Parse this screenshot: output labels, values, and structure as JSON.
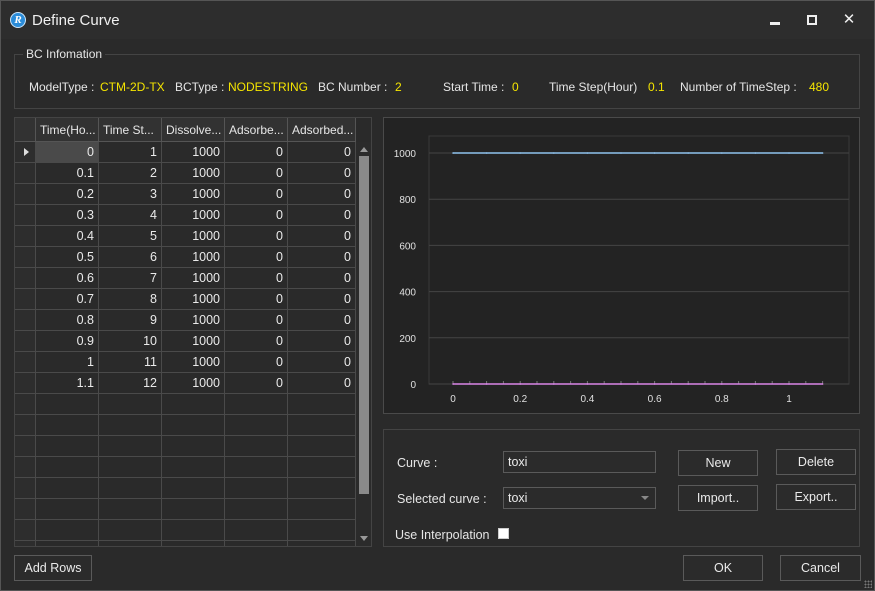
{
  "window": {
    "title": "Define Curve",
    "icon": "r-logo-icon"
  },
  "bc_info": {
    "group_title": "BC Infomation",
    "model_type_label": "ModelType :",
    "model_type_value": "CTM-2D-TX",
    "bc_type_label": "BCType :",
    "bc_type_value": "NODESTRING",
    "bc_number_label": "BC Number :",
    "bc_number_value": "2",
    "start_time_label": "Start Time :",
    "start_time_value": "0",
    "time_step_label": "Time Step(Hour)",
    "time_step_value": "0.1",
    "num_timestep_label": "Number of TimeStep :",
    "num_timestep_value": "480"
  },
  "grid": {
    "columns": [
      "Time(Ho...",
      "Time St...",
      "Dissolve...",
      "Adsorbe...",
      "Adsorbed..."
    ],
    "rows": [
      [
        "0",
        "1",
        "1000",
        "0",
        "0"
      ],
      [
        "0.1",
        "2",
        "1000",
        "0",
        "0"
      ],
      [
        "0.2",
        "3",
        "1000",
        "0",
        "0"
      ],
      [
        "0.3",
        "4",
        "1000",
        "0",
        "0"
      ],
      [
        "0.4",
        "5",
        "1000",
        "0",
        "0"
      ],
      [
        "0.5",
        "6",
        "1000",
        "0",
        "0"
      ],
      [
        "0.6",
        "7",
        "1000",
        "0",
        "0"
      ],
      [
        "0.7",
        "8",
        "1000",
        "0",
        "0"
      ],
      [
        "0.8",
        "9",
        "1000",
        "0",
        "0"
      ],
      [
        "0.9",
        "10",
        "1000",
        "0",
        "0"
      ],
      [
        "1",
        "11",
        "1000",
        "0",
        "0"
      ],
      [
        "1.1",
        "12",
        "1000",
        "0",
        "0"
      ]
    ],
    "empty_rows": 8
  },
  "chart_data": {
    "type": "line",
    "x": [
      0,
      0.1,
      0.2,
      0.3,
      0.4,
      0.5,
      0.6,
      0.7,
      0.8,
      0.9,
      1,
      1.1
    ],
    "series": [
      {
        "values": [
          1000,
          1000,
          1000,
          1000,
          1000,
          1000,
          1000,
          1000,
          1000,
          1000,
          1000,
          1000
        ],
        "color": "#8fc3ee"
      },
      {
        "values": [
          0,
          0,
          0,
          0,
          0,
          0,
          0,
          0,
          0,
          0,
          0,
          0
        ],
        "color": "#d986e8"
      }
    ],
    "xticks": [
      "0",
      "0.2",
      "0.4",
      "0.6",
      "0.8",
      "1"
    ],
    "yticks": [
      "0",
      "200",
      "400",
      "600",
      "800",
      "1000"
    ],
    "xlim": [
      0,
      1.1
    ],
    "ylim": [
      0,
      1000
    ],
    "grid": true
  },
  "controls": {
    "curve_label": "Curve :",
    "curve_value": "toxi",
    "selected_curve_label": "Selected curve :",
    "selected_curve_value": "toxi",
    "new_label": "New",
    "delete_label": "Delete",
    "import_label": "Import..",
    "export_label": "Export..",
    "interpolation_label": "Use Interpolation"
  },
  "footer": {
    "add_rows_label": "Add Rows",
    "ok_label": "OK",
    "cancel_label": "Cancel"
  }
}
